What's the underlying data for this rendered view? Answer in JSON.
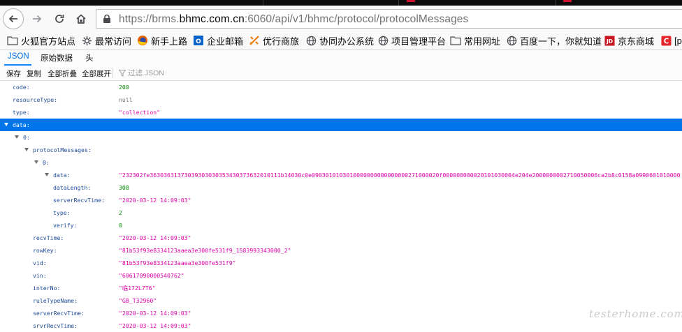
{
  "browser": {
    "url_prefix": "https://brms.",
    "url_domain": "bhmc.com.cn",
    "url_suffix": ":6060/api/v1/bhmc/protocol/protocolMessages"
  },
  "bookmarks": [
    {
      "label": "火狐官方站点",
      "icon": "folder-icon"
    },
    {
      "label": "最常访问",
      "icon": "gear-icon"
    },
    {
      "label": "新手上路",
      "icon": "firefox-icon"
    },
    {
      "label": "企业邮箱",
      "icon": "outlook-icon"
    },
    {
      "label": "优行商旅",
      "icon": "plane-icon"
    },
    {
      "label": "协同办公系统",
      "icon": "globe-icon"
    },
    {
      "label": "项目管理平台",
      "icon": "globe-icon"
    },
    {
      "label": "常用网址",
      "icon": "folder-icon"
    },
    {
      "label": "百度一下，你就知道",
      "icon": "globe-icon"
    },
    {
      "label": "京东商城",
      "icon": "jd-icon"
    },
    {
      "label": "[p",
      "icon": "c-icon"
    }
  ],
  "viewer_tabs": [
    "JSON",
    "原始数据",
    "头"
  ],
  "toolbar": {
    "save": "保存",
    "copy": "复制",
    "collapse_all": "全部折叠",
    "expand_all": "全部展开",
    "filter_placeholder": "过滤 JSON"
  },
  "rows": [
    {
      "key": "code:",
      "value": "200",
      "type": "num"
    },
    {
      "key": "resourceType:",
      "value": "null",
      "type": "null"
    },
    {
      "key": "type:",
      "value": "\"collection\"",
      "type": "str"
    },
    {
      "key": "data:",
      "value": "",
      "type": "obj"
    },
    {
      "key": "0:",
      "value": "",
      "type": "obj"
    },
    {
      "key": "protocolMessages:",
      "value": "",
      "type": "obj"
    },
    {
      "key": "0:",
      "value": "",
      "type": "obj"
    },
    {
      "key": "data:",
      "value": "\"232302fe36303631373039303030353430373632010111b14030c0e0903010103010000000000000000271000020f000000000020101030004e204e2000000002710050006ca2b8c0158a0990601010000",
      "type": "str"
    },
    {
      "key": "dataLength:",
      "value": "308",
      "type": "num"
    },
    {
      "key": "serverRecvTime:",
      "value": "\"2020-03-12 14:09:03\"",
      "type": "str"
    },
    {
      "key": "type:",
      "value": "2",
      "type": "num"
    },
    {
      "key": "verify:",
      "value": "0",
      "type": "num"
    },
    {
      "key": "recvTime:",
      "value": "\"2020-03-12 14:09:03\"",
      "type": "str"
    },
    {
      "key": "rowKey:",
      "value": "\"81b53f93e8334123aaea3e300fe531f9_1583993343000_2\"",
      "type": "str"
    },
    {
      "key": "vid:",
      "value": "\"81b53f93e8334123aaea3e300fe531f9\"",
      "type": "str"
    },
    {
      "key": "vin:",
      "value": "\"60617090000540762\"",
      "type": "str"
    },
    {
      "key": "interNo:",
      "value": "\"临172L7T6\"",
      "type": "str"
    },
    {
      "key": "ruleTypeName:",
      "value": "\"GB_T32960\"",
      "type": "str"
    },
    {
      "key": "serverRecvTime:",
      "value": "\"2020-03-12 14:09:03\"",
      "type": "str"
    },
    {
      "key": "srvrRecvTime:",
      "value": "\"2020-03-12 14:09:03\"",
      "type": "str"
    }
  ],
  "watermark": "testerhome.com",
  "colors": {
    "selected_row": "#0074e8",
    "key": "#1c4a98",
    "string": "#dd00a9",
    "number": "#058b00"
  }
}
